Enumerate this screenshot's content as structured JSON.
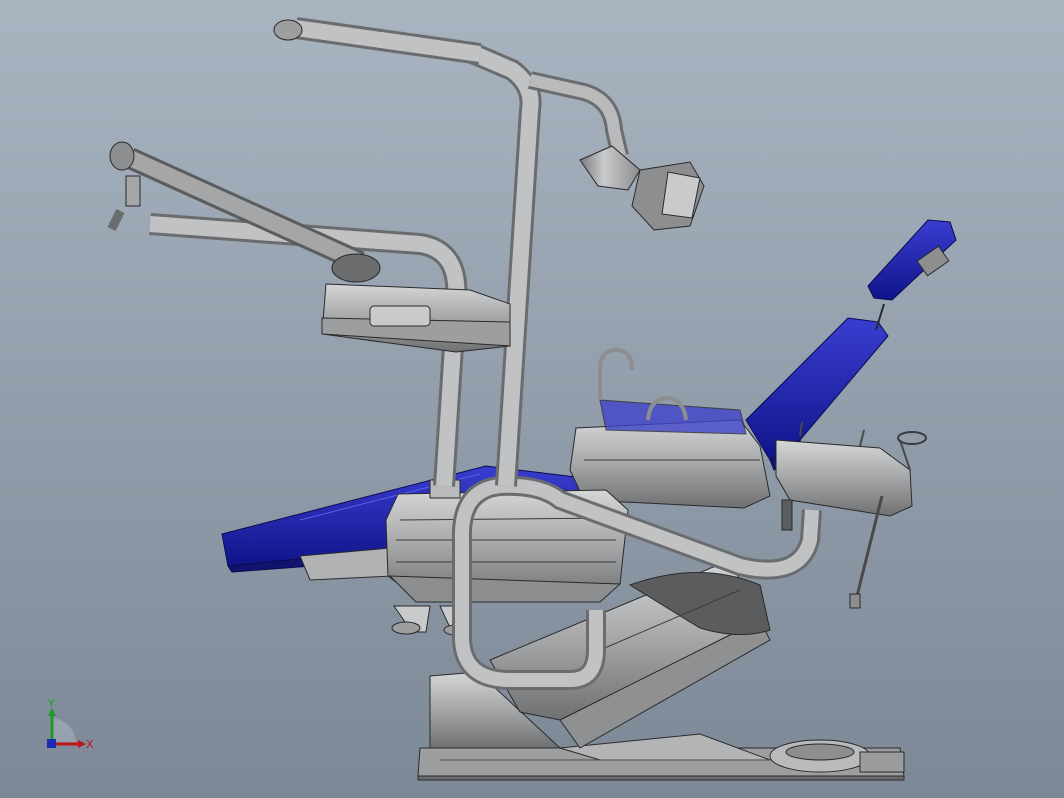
{
  "view": {
    "background_top": "#a9b4c1",
    "background_bottom": "#7d8896"
  },
  "colors": {
    "upholstery": "#1e22a8",
    "upholstery_dark": "#10146e",
    "metal": "#a4a6a8",
    "metal_light": "#c8cacc",
    "metal_dark": "#6a6c6e",
    "edge": "#2a2a2a"
  },
  "triad": {
    "x_label": "X",
    "y_label": "Y",
    "x_color": "#c0161b",
    "y_color": "#1f9a2a",
    "z_color": "#1a2bb8"
  }
}
